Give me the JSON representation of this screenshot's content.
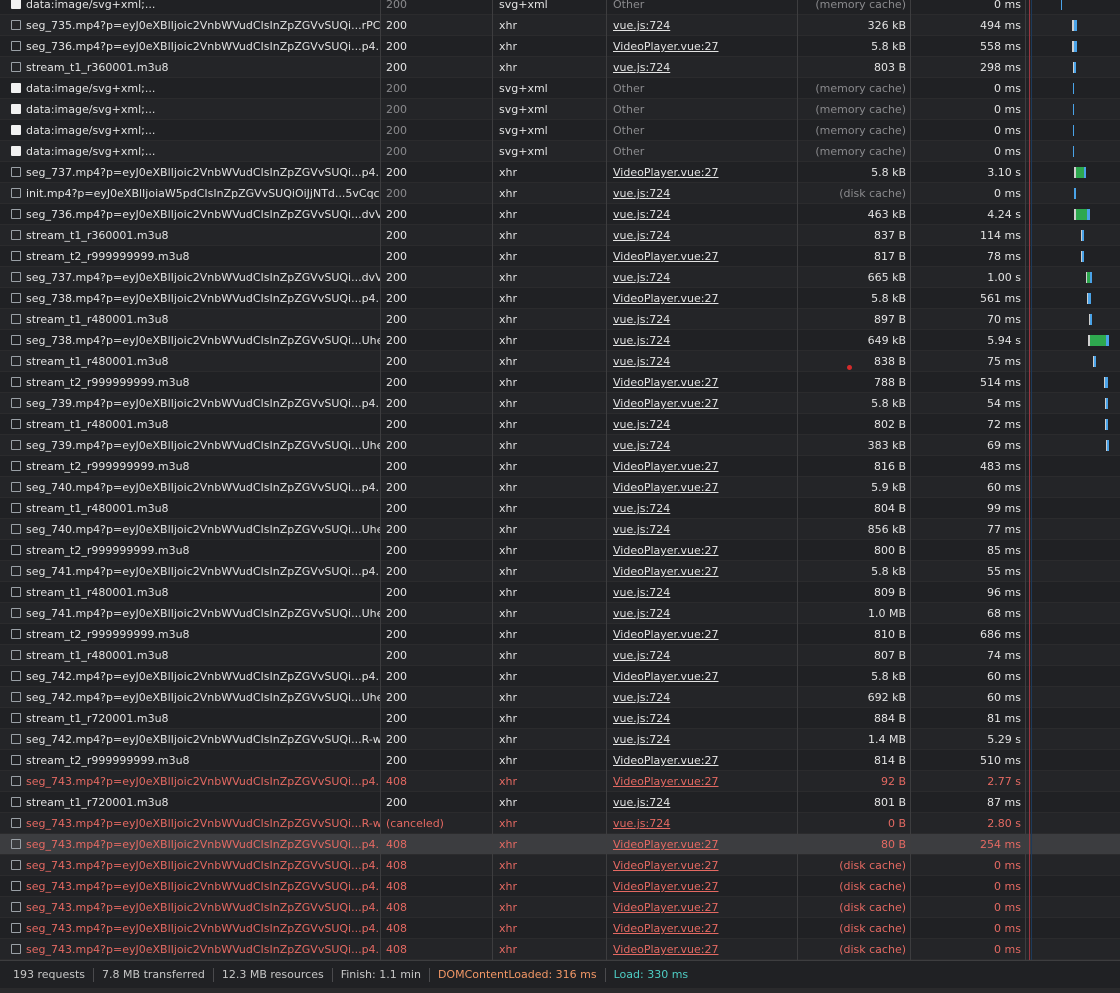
{
  "requests": [
    {
      "name": "data:image/svg+xml;...",
      "status": "200",
      "type": "svg+xml",
      "initiator": "Other",
      "size": "(memory cache)",
      "time": "0 ms",
      "icon": "image",
      "dim": true,
      "wf": [
        {
          "l": 35,
          "w": 1,
          "c": "#4aa3e8"
        }
      ]
    },
    {
      "name": "seg_735.mp4?p=eyJ0eXBlIjoic2VnbWVudCIsInZpZGVvSUQi...rPCj...",
      "status": "200",
      "type": "xhr",
      "initiator": "vue.js:724",
      "size": "326 kB",
      "time": "494 ms",
      "icon": "doc",
      "wf": [
        {
          "l": 46,
          "w": 2,
          "c": "#cfcfcf"
        },
        {
          "l": 48,
          "w": 3,
          "c": "#4aa3e8"
        }
      ]
    },
    {
      "name": "seg_736.mp4?p=eyJ0eXBlIjoic2VnbWVudCIsInZpZGVvSUQi...p4...",
      "status": "200",
      "type": "xhr",
      "initiator": "VideoPlayer.vue:27",
      "size": "5.8 kB",
      "time": "558 ms",
      "icon": "doc",
      "wf": [
        {
          "l": 46,
          "w": 2,
          "c": "#cfcfcf"
        },
        {
          "l": 48,
          "w": 3,
          "c": "#4aa3e8"
        }
      ]
    },
    {
      "name": "stream_t1_r360001.m3u8",
      "status": "200",
      "type": "xhr",
      "initiator": "vue.js:724",
      "size": "803 B",
      "time": "298 ms",
      "icon": "doc",
      "wf": [
        {
          "l": 47,
          "w": 1,
          "c": "#cfcfcf"
        },
        {
          "l": 48,
          "w": 2,
          "c": "#4aa3e8"
        }
      ]
    },
    {
      "name": "data:image/svg+xml;...",
      "status": "200",
      "type": "svg+xml",
      "initiator": "Other",
      "size": "(memory cache)",
      "time": "0 ms",
      "icon": "image",
      "dim": true,
      "wf": [
        {
          "l": 47,
          "w": 1,
          "c": "#4aa3e8"
        }
      ]
    },
    {
      "name": "data:image/svg+xml;...",
      "status": "200",
      "type": "svg+xml",
      "initiator": "Other",
      "size": "(memory cache)",
      "time": "0 ms",
      "icon": "image",
      "dim": true,
      "wf": [
        {
          "l": 47,
          "w": 1,
          "c": "#4aa3e8"
        }
      ]
    },
    {
      "name": "data:image/svg+xml;...",
      "status": "200",
      "type": "svg+xml",
      "initiator": "Other",
      "size": "(memory cache)",
      "time": "0 ms",
      "icon": "image",
      "dim": true,
      "wf": [
        {
          "l": 47,
          "w": 1,
          "c": "#4aa3e8"
        }
      ]
    },
    {
      "name": "data:image/svg+xml;...",
      "status": "200",
      "type": "svg+xml",
      "initiator": "Other",
      "size": "(memory cache)",
      "time": "0 ms",
      "icon": "image",
      "dim": true,
      "wf": [
        {
          "l": 47,
          "w": 1,
          "c": "#4aa3e8"
        }
      ]
    },
    {
      "name": "seg_737.mp4?p=eyJ0eXBlIjoic2VnbWVudCIsInZpZGVvSUQi...p4...",
      "status": "200",
      "type": "xhr",
      "initiator": "VideoPlayer.vue:27",
      "size": "5.8 kB",
      "time": "3.10 s",
      "icon": "doc",
      "wf": [
        {
          "l": 48,
          "w": 2,
          "c": "#cfcfcf"
        },
        {
          "l": 50,
          "w": 8,
          "c": "#2ea84f"
        },
        {
          "l": 58,
          "w": 2,
          "c": "#4aa3e8"
        }
      ]
    },
    {
      "name": "init.mp4?p=eyJ0eXBlIjoiaW5pdCIsInZpZGVvSUQiOiJjNTd...5vCqc...",
      "status": "200",
      "type": "xhr",
      "initiator": "vue.js:724",
      "size": "(disk cache)",
      "time": "0 ms",
      "icon": "doc",
      "dim": true,
      "wf": [
        {
          "l": 48,
          "w": 2,
          "c": "#4aa3e8"
        }
      ]
    },
    {
      "name": "seg_736.mp4?p=eyJ0eXBlIjoic2VnbWVudCIsInZpZGVvSUQi...dvV...",
      "status": "200",
      "type": "xhr",
      "initiator": "vue.js:724",
      "size": "463 kB",
      "time": "4.24 s",
      "icon": "doc",
      "wf": [
        {
          "l": 48,
          "w": 2,
          "c": "#cfcfcf"
        },
        {
          "l": 50,
          "w": 11,
          "c": "#2ea84f"
        },
        {
          "l": 61,
          "w": 3,
          "c": "#4aa3e8"
        }
      ]
    },
    {
      "name": "stream_t1_r360001.m3u8",
      "status": "200",
      "type": "xhr",
      "initiator": "vue.js:724",
      "size": "837 B",
      "time": "114 ms",
      "icon": "doc",
      "wf": [
        {
          "l": 55,
          "w": 1,
          "c": "#cfcfcf"
        },
        {
          "l": 56,
          "w": 2,
          "c": "#4aa3e8"
        }
      ]
    },
    {
      "name": "stream_t2_r999999999.m3u8",
      "status": "200",
      "type": "xhr",
      "initiator": "VideoPlayer.vue:27",
      "size": "817 B",
      "time": "78 ms",
      "icon": "doc",
      "wf": [
        {
          "l": 55,
          "w": 1,
          "c": "#cfcfcf"
        },
        {
          "l": 56,
          "w": 2,
          "c": "#4aa3e8"
        }
      ]
    },
    {
      "name": "seg_737.mp4?p=eyJ0eXBlIjoic2VnbWVudCIsInZpZGVvSUQi...dvV...",
      "status": "200",
      "type": "xhr",
      "initiator": "vue.js:724",
      "size": "665 kB",
      "time": "1.00 s",
      "icon": "doc",
      "wf": [
        {
          "l": 60,
          "w": 1,
          "c": "#cfcfcf"
        },
        {
          "l": 61,
          "w": 3,
          "c": "#2ea84f"
        },
        {
          "l": 64,
          "w": 2,
          "c": "#4aa3e8"
        }
      ]
    },
    {
      "name": "seg_738.mp4?p=eyJ0eXBlIjoic2VnbWVudCIsInZpZGVvSUQi...p4...",
      "status": "200",
      "type": "xhr",
      "initiator": "VideoPlayer.vue:27",
      "size": "5.8 kB",
      "time": "561 ms",
      "icon": "doc",
      "wf": [
        {
          "l": 61,
          "w": 1,
          "c": "#cfcfcf"
        },
        {
          "l": 62,
          "w": 3,
          "c": "#4aa3e8"
        }
      ]
    },
    {
      "name": "stream_t1_r480001.m3u8",
      "status": "200",
      "type": "xhr",
      "initiator": "vue.js:724",
      "size": "897 B",
      "time": "70 ms",
      "icon": "doc",
      "wf": [
        {
          "l": 63,
          "w": 1,
          "c": "#cfcfcf"
        },
        {
          "l": 64,
          "w": 2,
          "c": "#4aa3e8"
        }
      ]
    },
    {
      "name": "seg_738.mp4?p=eyJ0eXBlIjoic2VnbWVudCIsInZpZGVvSUQi...Uhe...",
      "status": "200",
      "type": "xhr",
      "initiator": "vue.js:724",
      "size": "649 kB",
      "time": "5.94 s",
      "icon": "doc",
      "wf": [
        {
          "l": 62,
          "w": 2,
          "c": "#cfcfcf"
        },
        {
          "l": 64,
          "w": 16,
          "c": "#2ea84f"
        },
        {
          "l": 80,
          "w": 3,
          "c": "#4aa3e8"
        }
      ]
    },
    {
      "name": "stream_t1_r480001.m3u8",
      "status": "200",
      "type": "xhr",
      "initiator": "vue.js:724",
      "size": "838 B",
      "time": "75 ms",
      "icon": "doc",
      "wf": [
        {
          "l": 67,
          "w": 1,
          "c": "#cfcfcf"
        },
        {
          "l": 68,
          "w": 2,
          "c": "#4aa3e8"
        }
      ]
    },
    {
      "name": "stream_t2_r999999999.m3u8",
      "status": "200",
      "type": "xhr",
      "initiator": "VideoPlayer.vue:27",
      "size": "788 B",
      "time": "514 ms",
      "icon": "doc",
      "wf": [
        {
          "l": 78,
          "w": 1,
          "c": "#cfcfcf"
        },
        {
          "l": 79,
          "w": 3,
          "c": "#4aa3e8"
        }
      ]
    },
    {
      "name": "seg_739.mp4?p=eyJ0eXBlIjoic2VnbWVudCIsInZpZGVvSUQi...p4...",
      "status": "200",
      "type": "xhr",
      "initiator": "VideoPlayer.vue:27",
      "size": "5.8 kB",
      "time": "54 ms",
      "icon": "doc",
      "wf": [
        {
          "l": 79,
          "w": 1,
          "c": "#cfcfcf"
        },
        {
          "l": 80,
          "w": 2,
          "c": "#4aa3e8"
        }
      ]
    },
    {
      "name": "stream_t1_r480001.m3u8",
      "status": "200",
      "type": "xhr",
      "initiator": "vue.js:724",
      "size": "802 B",
      "time": "72 ms",
      "icon": "doc",
      "wf": [
        {
          "l": 79,
          "w": 1,
          "c": "#cfcfcf"
        },
        {
          "l": 80,
          "w": 2,
          "c": "#4aa3e8"
        }
      ]
    },
    {
      "name": "seg_739.mp4?p=eyJ0eXBlIjoic2VnbWVudCIsInZpZGVvSUQi...Uhe...",
      "status": "200",
      "type": "xhr",
      "initiator": "vue.js:724",
      "size": "383 kB",
      "time": "69 ms",
      "icon": "doc",
      "wf": [
        {
          "l": 80,
          "w": 1,
          "c": "#cfcfcf"
        },
        {
          "l": 81,
          "w": 2,
          "c": "#4aa3e8"
        }
      ]
    },
    {
      "name": "stream_t2_r999999999.m3u8",
      "status": "200",
      "type": "xhr",
      "initiator": "VideoPlayer.vue:27",
      "size": "816 B",
      "time": "483 ms",
      "icon": "doc"
    },
    {
      "name": "seg_740.mp4?p=eyJ0eXBlIjoic2VnbWVudCIsInZpZGVvSUQi...p4...",
      "status": "200",
      "type": "xhr",
      "initiator": "VideoPlayer.vue:27",
      "size": "5.9 kB",
      "time": "60 ms",
      "icon": "doc"
    },
    {
      "name": "stream_t1_r480001.m3u8",
      "status": "200",
      "type": "xhr",
      "initiator": "vue.js:724",
      "size": "804 B",
      "time": "99 ms",
      "icon": "doc"
    },
    {
      "name": "seg_740.mp4?p=eyJ0eXBlIjoic2VnbWVudCIsInZpZGVvSUQi...Uhe...",
      "status": "200",
      "type": "xhr",
      "initiator": "vue.js:724",
      "size": "856 kB",
      "time": "77 ms",
      "icon": "doc"
    },
    {
      "name": "stream_t2_r999999999.m3u8",
      "status": "200",
      "type": "xhr",
      "initiator": "VideoPlayer.vue:27",
      "size": "800 B",
      "time": "85 ms",
      "icon": "doc"
    },
    {
      "name": "seg_741.mp4?p=eyJ0eXBlIjoic2VnbWVudCIsInZpZGVvSUQi...p4...",
      "status": "200",
      "type": "xhr",
      "initiator": "VideoPlayer.vue:27",
      "size": "5.8 kB",
      "time": "55 ms",
      "icon": "doc"
    },
    {
      "name": "stream_t1_r480001.m3u8",
      "status": "200",
      "type": "xhr",
      "initiator": "vue.js:724",
      "size": "809 B",
      "time": "96 ms",
      "icon": "doc"
    },
    {
      "name": "seg_741.mp4?p=eyJ0eXBlIjoic2VnbWVudCIsInZpZGVvSUQi...Uhe...",
      "status": "200",
      "type": "xhr",
      "initiator": "vue.js:724",
      "size": "1.0 MB",
      "time": "68 ms",
      "icon": "doc"
    },
    {
      "name": "stream_t2_r999999999.m3u8",
      "status": "200",
      "type": "xhr",
      "initiator": "VideoPlayer.vue:27",
      "size": "810 B",
      "time": "686 ms",
      "icon": "doc"
    },
    {
      "name": "stream_t1_r480001.m3u8",
      "status": "200",
      "type": "xhr",
      "initiator": "vue.js:724",
      "size": "807 B",
      "time": "74 ms",
      "icon": "doc"
    },
    {
      "name": "seg_742.mp4?p=eyJ0eXBlIjoic2VnbWVudCIsInZpZGVvSUQi...p4...",
      "status": "200",
      "type": "xhr",
      "initiator": "VideoPlayer.vue:27",
      "size": "5.8 kB",
      "time": "60 ms",
      "icon": "doc"
    },
    {
      "name": "seg_742.mp4?p=eyJ0eXBlIjoic2VnbWVudCIsInZpZGVvSUQi...Uhe...",
      "status": "200",
      "type": "xhr",
      "initiator": "vue.js:724",
      "size": "692 kB",
      "time": "60 ms",
      "icon": "doc"
    },
    {
      "name": "stream_t1_r720001.m3u8",
      "status": "200",
      "type": "xhr",
      "initiator": "vue.js:724",
      "size": "884 B",
      "time": "81 ms",
      "icon": "doc"
    },
    {
      "name": "seg_742.mp4?p=eyJ0eXBlIjoic2VnbWVudCIsInZpZGVvSUQi...R-w...",
      "status": "200",
      "type": "xhr",
      "initiator": "vue.js:724",
      "size": "1.4 MB",
      "time": "5.29 s",
      "icon": "doc"
    },
    {
      "name": "stream_t2_r999999999.m3u8",
      "status": "200",
      "type": "xhr",
      "initiator": "VideoPlayer.vue:27",
      "size": "814 B",
      "time": "510 ms",
      "icon": "doc"
    },
    {
      "name": "seg_743.mp4?p=eyJ0eXBlIjoic2VnbWVudCIsInZpZGVvSUQi...p4...",
      "status": "408",
      "type": "xhr",
      "initiator": "VideoPlayer.vue:27",
      "size": "92 B",
      "time": "2.77 s",
      "icon": "doc",
      "error": true
    },
    {
      "name": "stream_t1_r720001.m3u8",
      "status": "200",
      "type": "xhr",
      "initiator": "vue.js:724",
      "size": "801 B",
      "time": "87 ms",
      "icon": "doc"
    },
    {
      "name": "seg_743.mp4?p=eyJ0eXBlIjoic2VnbWVudCIsInZpZGVvSUQi...R-w...",
      "status": "(canceled)",
      "type": "xhr",
      "initiator": "vue.js:724",
      "size": "0 B",
      "time": "2.80 s",
      "icon": "doc",
      "error": true
    },
    {
      "name": "seg_743.mp4?p=eyJ0eXBlIjoic2VnbWVudCIsInZpZGVvSUQi...p4...",
      "status": "408",
      "type": "xhr",
      "initiator": "VideoPlayer.vue:27",
      "size": "80 B",
      "time": "254 ms",
      "icon": "doc",
      "error": true,
      "selected": true
    },
    {
      "name": "seg_743.mp4?p=eyJ0eXBlIjoic2VnbWVudCIsInZpZGVvSUQi...p4...",
      "status": "408",
      "type": "xhr",
      "initiator": "VideoPlayer.vue:27",
      "size": "(disk cache)",
      "time": "0 ms",
      "icon": "doc",
      "error": true,
      "cached": true
    },
    {
      "name": "seg_743.mp4?p=eyJ0eXBlIjoic2VnbWVudCIsInZpZGVvSUQi...p4...",
      "status": "408",
      "type": "xhr",
      "initiator": "VideoPlayer.vue:27",
      "size": "(disk cache)",
      "time": "0 ms",
      "icon": "doc",
      "error": true,
      "cached": true
    },
    {
      "name": "seg_743.mp4?p=eyJ0eXBlIjoic2VnbWVudCIsInZpZGVvSUQi...p4...",
      "status": "408",
      "type": "xhr",
      "initiator": "VideoPlayer.vue:27",
      "size": "(disk cache)",
      "time": "0 ms",
      "icon": "doc",
      "error": true,
      "cached": true
    },
    {
      "name": "seg_743.mp4?p=eyJ0eXBlIjoic2VnbWVudCIsInZpZGVvSUQi...p4...",
      "status": "408",
      "type": "xhr",
      "initiator": "VideoPlayer.vue:27",
      "size": "(disk cache)",
      "time": "0 ms",
      "icon": "doc",
      "error": true,
      "cached": true
    },
    {
      "name": "seg_743.mp4?p=eyJ0eXBlIjoic2VnbWVudCIsInZpZGVvSUQi...p4...",
      "status": "408",
      "type": "xhr",
      "initiator": "VideoPlayer.vue:27",
      "size": "(disk cache)",
      "time": "0 ms",
      "icon": "doc",
      "error": true,
      "cached": true
    }
  ],
  "summary": {
    "requests": "193 requests",
    "transferred": "7.8 MB transferred",
    "resources": "12.3 MB resources",
    "finish": "Finish: 1.1 min",
    "domcontentloaded": "DOMContentLoaded: 316 ms",
    "load": "Load: 330 ms"
  },
  "colors": {
    "error": "#e46962",
    "domcontentloaded": "#f29766",
    "load": "#4ecdc4",
    "waiting": "#2ea84f",
    "download": "#4aa3e8"
  }
}
